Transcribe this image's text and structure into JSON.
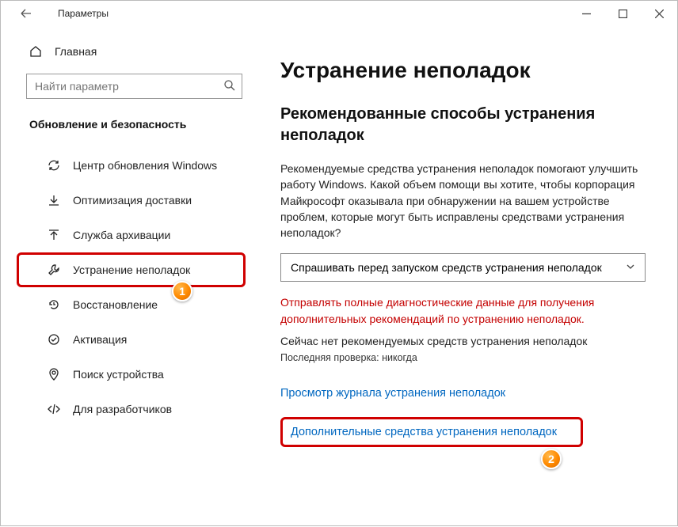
{
  "window": {
    "title": "Параметры"
  },
  "sidebar": {
    "home": "Главная",
    "search_placeholder": "Найти параметр",
    "section": "Обновление и безопасность",
    "items": [
      {
        "label": "Центр обновления Windows"
      },
      {
        "label": "Оптимизация доставки"
      },
      {
        "label": "Служба архивации"
      },
      {
        "label": "Устранение неполадок"
      },
      {
        "label": "Восстановление"
      },
      {
        "label": "Активация"
      },
      {
        "label": "Поиск устройства"
      },
      {
        "label": "Для разработчиков"
      }
    ]
  },
  "main": {
    "h1": "Устранение неполадок",
    "h2": "Рекомендованные способы устранения неполадок",
    "desc": "Рекомендуемые средства устранения неполадок помогают улучшить работу Windows. Какой объем помощи вы хотите, чтобы корпорация Майкрософт оказывала при обнаружении на вашем устройстве проблем, которые могут быть исправлены средствами устранения неполадок?",
    "dropdown": "Спрашивать перед запуском средств устранения неполадок",
    "red": "Отправлять полные диагностические данные для получения дополнительных рекомендаций по устранению неполадок.",
    "none": "Сейчас нет рекомендуемых средств устранения неполадок",
    "last": "Последняя проверка: никогда",
    "link1": "Просмотр журнала устранения неполадок",
    "link2": "Дополнительные средства устранения неполадок"
  },
  "badges": {
    "b1": "1",
    "b2": "2"
  }
}
